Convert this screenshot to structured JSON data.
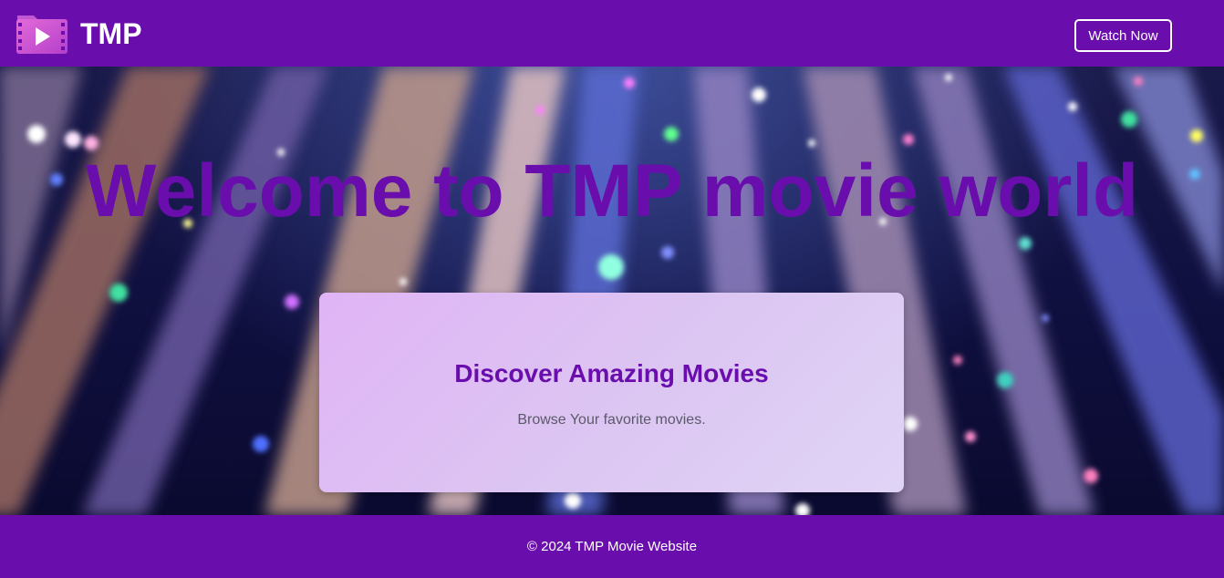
{
  "header": {
    "brand": "TMP",
    "logo_icon": "film-folder-play-icon",
    "watch_button": "Watch Now"
  },
  "hero": {
    "title": "Welcome to TMP movie world",
    "background": "light-streaks-sparkles"
  },
  "card": {
    "title": "Discover Amazing Movies",
    "subtitle": "Browse Your favorite movies."
  },
  "footer": {
    "text": "© 2024 TMP Movie Website"
  },
  "colors": {
    "brand_purple": "#6a0dad",
    "card_bg": "#dcc6f2",
    "text_white": "#ffffff",
    "subtext_gray": "#5a5a6a"
  }
}
